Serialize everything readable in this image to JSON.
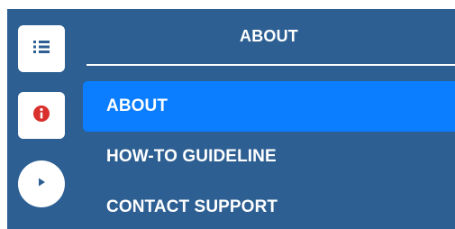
{
  "sidebar": {
    "buttons": [
      {
        "icon": "list-icon",
        "color": "#2d5f93"
      },
      {
        "icon": "info-icon",
        "color": "#d9302c"
      },
      {
        "icon": "play-icon",
        "color": "#2d5f93"
      }
    ]
  },
  "panel": {
    "title": "ABOUT",
    "items": [
      {
        "label": "ABOUT",
        "active": true
      },
      {
        "label": "HOW-TO GUIDELINE",
        "active": false
      },
      {
        "label": "CONTACT SUPPORT",
        "active": false
      }
    ]
  },
  "colors": {
    "background": "#2d5f93",
    "active_item": "#0b7dff",
    "text": "#ffffff"
  }
}
